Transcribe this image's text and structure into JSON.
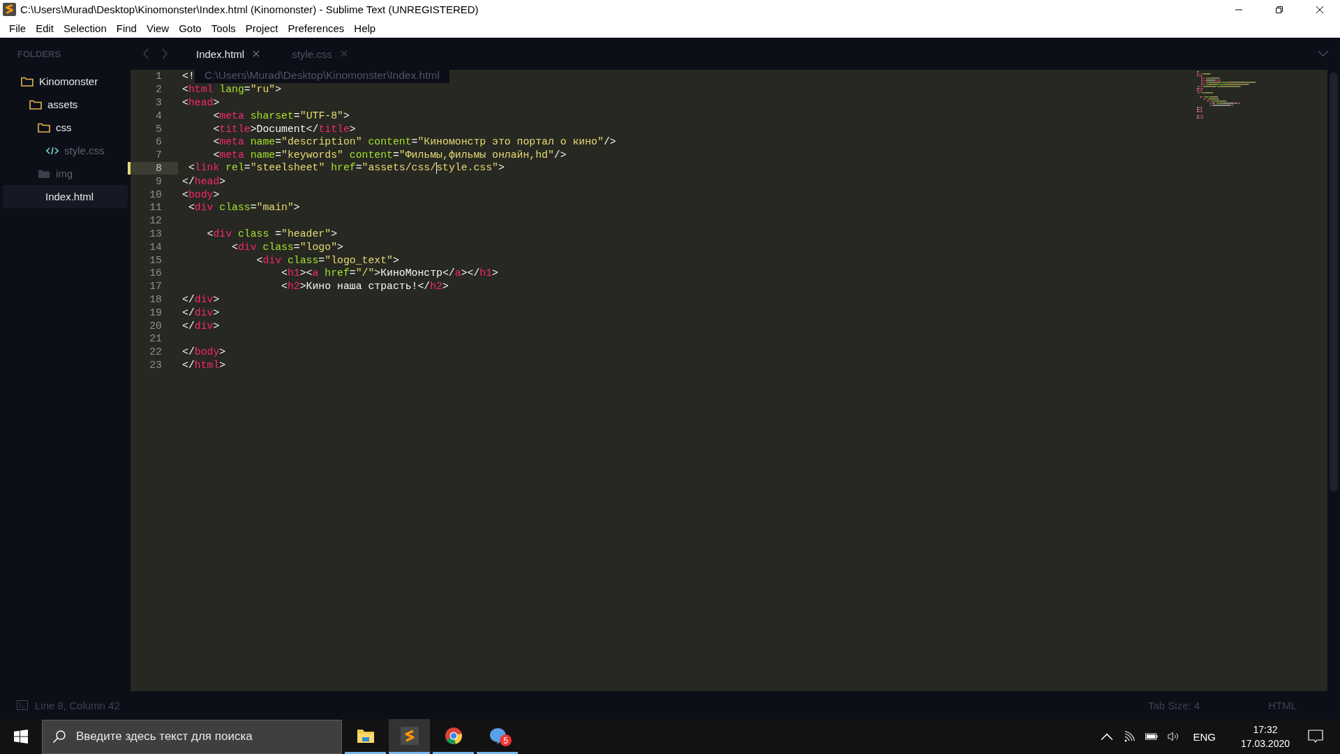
{
  "window": {
    "title": "C:\\Users\\Murad\\Desktop\\Kinomonster\\Index.html (Kinomonster) - Sublime Text (UNREGISTERED)"
  },
  "menu": [
    "File",
    "Edit",
    "Selection",
    "Find",
    "View",
    "Goto",
    "Tools",
    "Project",
    "Preferences",
    "Help"
  ],
  "sidebar": {
    "header": "FOLDERS",
    "items": [
      {
        "kind": "folder",
        "label": "Kinomonster",
        "expanded": true,
        "selected": false,
        "children": [
          {
            "kind": "folder",
            "label": "assets",
            "expanded": true,
            "selected": false,
            "children": [
              {
                "kind": "folder",
                "label": "css",
                "expanded": true,
                "selected": false,
                "children": [
                  {
                    "kind": "source",
                    "label": "style.css",
                    "selected": false
                  }
                ]
              },
              {
                "kind": "folder",
                "label": "img",
                "expanded": false,
                "selected": false
              }
            ]
          },
          {
            "kind": "file",
            "label": "Index.html",
            "selected": true
          }
        ]
      }
    ]
  },
  "tabs": [
    {
      "label": "Index.html",
      "selected": true
    },
    {
      "label": "style.css",
      "selected": false
    }
  ],
  "tooltip": "C:\\Users\\Murad\\Desktop\\Kinomonster\\Index.html",
  "code": [
    {
      "number": "1",
      "current": false,
      "tokens": [
        {
          "kind": "punct",
          "text": "<!"
        }
      ]
    },
    {
      "number": "2",
      "current": false,
      "tokens": [
        {
          "kind": "punct",
          "text": "<"
        },
        {
          "kind": "tag",
          "text": "html"
        },
        {
          "kind": "attr",
          "text": " lang"
        },
        {
          "kind": "punct",
          "text": "="
        },
        {
          "kind": "string",
          "text": "\"ru\""
        },
        {
          "kind": "punct",
          "text": ">"
        }
      ]
    },
    {
      "number": "3",
      "current": false,
      "tokens": [
        {
          "kind": "punct",
          "text": "<"
        },
        {
          "kind": "tag",
          "text": "head"
        },
        {
          "kind": "punct",
          "text": ">"
        }
      ]
    },
    {
      "number": "4",
      "current": false,
      "tokens": [
        {
          "kind": "punct",
          "text": "     <"
        },
        {
          "kind": "tag",
          "text": "meta"
        },
        {
          "kind": "attr",
          "text": " sharset"
        },
        {
          "kind": "punct",
          "text": "="
        },
        {
          "kind": "string",
          "text": "\"UTF-8\""
        },
        {
          "kind": "punct",
          "text": ">"
        }
      ]
    },
    {
      "number": "5",
      "current": false,
      "tokens": [
        {
          "kind": "punct",
          "text": "     <"
        },
        {
          "kind": "tag",
          "text": "title"
        },
        {
          "kind": "punct",
          "text": ">Document</"
        },
        {
          "kind": "tag",
          "text": "title"
        },
        {
          "kind": "punct",
          "text": ">"
        }
      ]
    },
    {
      "number": "6",
      "current": false,
      "tokens": [
        {
          "kind": "punct",
          "text": "     <"
        },
        {
          "kind": "tag",
          "text": "meta"
        },
        {
          "kind": "attr",
          "text": " name"
        },
        {
          "kind": "punct",
          "text": "="
        },
        {
          "kind": "string",
          "text": "\"description\""
        },
        {
          "kind": "attr",
          "text": " content"
        },
        {
          "kind": "punct",
          "text": "="
        },
        {
          "kind": "string",
          "text": "\"Киномонстр это портал о кино\""
        },
        {
          "kind": "punct",
          "text": "/>"
        }
      ]
    },
    {
      "number": "7",
      "current": false,
      "tokens": [
        {
          "kind": "punct",
          "text": "     <"
        },
        {
          "kind": "tag",
          "text": "meta"
        },
        {
          "kind": "attr",
          "text": " name"
        },
        {
          "kind": "punct",
          "text": "="
        },
        {
          "kind": "string",
          "text": "\"keywords\""
        },
        {
          "kind": "attr",
          "text": " content"
        },
        {
          "kind": "punct",
          "text": "="
        },
        {
          "kind": "string",
          "text": "\"Фильмы,фильмы онлайн,hd\""
        },
        {
          "kind": "punct",
          "text": "/>"
        }
      ]
    },
    {
      "number": "8",
      "current": true,
      "tokens": [
        {
          "kind": "punct",
          "text": " <"
        },
        {
          "kind": "tag",
          "text": "link"
        },
        {
          "kind": "attr",
          "text": " rel"
        },
        {
          "kind": "punct",
          "text": "="
        },
        {
          "kind": "string",
          "text": "\"steelsheet\""
        },
        {
          "kind": "attr",
          "text": " href"
        },
        {
          "kind": "punct",
          "text": "="
        },
        {
          "kind": "string",
          "text": "\"assets/css/"
        },
        {
          "kind": "cursor"
        },
        {
          "kind": "string",
          "text": "style.css\""
        },
        {
          "kind": "punct",
          "text": ">"
        }
      ]
    },
    {
      "number": "9",
      "current": false,
      "tokens": [
        {
          "kind": "punct",
          "text": "</"
        },
        {
          "kind": "tag",
          "text": "head"
        },
        {
          "kind": "punct",
          "text": ">"
        }
      ]
    },
    {
      "number": "10",
      "current": false,
      "tokens": [
        {
          "kind": "punct",
          "text": "<"
        },
        {
          "kind": "tag",
          "text": "body"
        },
        {
          "kind": "punct",
          "text": ">"
        }
      ]
    },
    {
      "number": "11",
      "current": false,
      "tokens": [
        {
          "kind": "punct",
          "text": " <"
        },
        {
          "kind": "tag",
          "text": "div"
        },
        {
          "kind": "attr",
          "text": " class"
        },
        {
          "kind": "punct",
          "text": "="
        },
        {
          "kind": "string",
          "text": "\"main\""
        },
        {
          "kind": "punct",
          "text": ">"
        }
      ]
    },
    {
      "number": "12",
      "current": false
    },
    {
      "number": "13",
      "current": false,
      "tokens": [
        {
          "kind": "punct",
          "text": "    <"
        },
        {
          "kind": "tag",
          "text": "div"
        },
        {
          "kind": "attr",
          "text": " class"
        },
        {
          "kind": "punct",
          "text": " ="
        },
        {
          "kind": "string",
          "text": "\"header\""
        },
        {
          "kind": "punct",
          "text": ">"
        }
      ]
    },
    {
      "number": "14",
      "current": false,
      "tokens": [
        {
          "kind": "punct",
          "text": "        <"
        },
        {
          "kind": "tag",
          "text": "div"
        },
        {
          "kind": "attr",
          "text": " class"
        },
        {
          "kind": "punct",
          "text": "="
        },
        {
          "kind": "string",
          "text": "\"logo\""
        },
        {
          "kind": "punct",
          "text": ">"
        }
      ]
    },
    {
      "number": "15",
      "current": false,
      "tokens": [
        {
          "kind": "punct",
          "text": "            <"
        },
        {
          "kind": "tag",
          "text": "div"
        },
        {
          "kind": "attr",
          "text": " class"
        },
        {
          "kind": "punct",
          "text": "="
        },
        {
          "kind": "string",
          "text": "\"logo_text\""
        },
        {
          "kind": "punct",
          "text": ">"
        }
      ]
    },
    {
      "number": "16",
      "current": false,
      "tokens": [
        {
          "kind": "punct",
          "text": "                <"
        },
        {
          "kind": "tag",
          "text": "h1"
        },
        {
          "kind": "punct",
          "text": "><"
        },
        {
          "kind": "tag",
          "text": "a"
        },
        {
          "kind": "attr",
          "text": " href"
        },
        {
          "kind": "punct",
          "text": "="
        },
        {
          "kind": "string",
          "text": "\"/\""
        },
        {
          "kind": "punct",
          "text": ">КиноМонстр</"
        },
        {
          "kind": "tag",
          "text": "a"
        },
        {
          "kind": "punct",
          "text": "></"
        },
        {
          "kind": "tag",
          "text": "h1"
        },
        {
          "kind": "punct",
          "text": ">"
        }
      ]
    },
    {
      "number": "17",
      "current": false,
      "tokens": [
        {
          "kind": "punct",
          "text": "                <"
        },
        {
          "kind": "tag",
          "text": "h2"
        },
        {
          "kind": "punct",
          "text": ">Кино наша страсть!</"
        },
        {
          "kind": "tag",
          "text": "h2"
        },
        {
          "kind": "punct",
          "text": ">"
        }
      ]
    },
    {
      "number": "18",
      "current": false,
      "tokens": [
        {
          "kind": "punct",
          "text": "</"
        },
        {
          "kind": "tag",
          "text": "div"
        },
        {
          "kind": "punct",
          "text": ">"
        }
      ]
    },
    {
      "number": "19",
      "current": false,
      "tokens": [
        {
          "kind": "punct",
          "text": "</"
        },
        {
          "kind": "tag",
          "text": "div"
        },
        {
          "kind": "punct",
          "text": ">"
        }
      ]
    },
    {
      "number": "20",
      "current": false,
      "tokens": [
        {
          "kind": "punct",
          "text": "</"
        },
        {
          "kind": "tag",
          "text": "div"
        },
        {
          "kind": "punct",
          "text": ">"
        }
      ]
    },
    {
      "number": "21",
      "current": false
    },
    {
      "number": "22",
      "current": false,
      "tokens": [
        {
          "kind": "punct",
          "text": "</"
        },
        {
          "kind": "tag",
          "text": "body"
        },
        {
          "kind": "punct",
          "text": ">"
        }
      ]
    },
    {
      "number": "23",
      "current": false,
      "tokens": [
        {
          "kind": "punct",
          "text": "</"
        },
        {
          "kind": "tag",
          "text": "html"
        },
        {
          "kind": "punct",
          "text": ">"
        }
      ]
    }
  ],
  "status_bar": {
    "position": "Line 8, Column 42",
    "tab_size": "Tab Size: 4",
    "syntax": "HTML"
  },
  "taskbar": {
    "search": {
      "placeholder": "Введите здесь текст для поиска"
    },
    "apps": [
      {
        "kind": "explorer",
        "selected": false
      },
      {
        "kind": "sublime",
        "selected": true
      },
      {
        "kind": "chrome",
        "selected": false
      },
      {
        "kind": "messenger",
        "selected": false,
        "badge": "5"
      }
    ],
    "language": "ENG",
    "time": "17:32",
    "date": "17.03.2020"
  }
}
